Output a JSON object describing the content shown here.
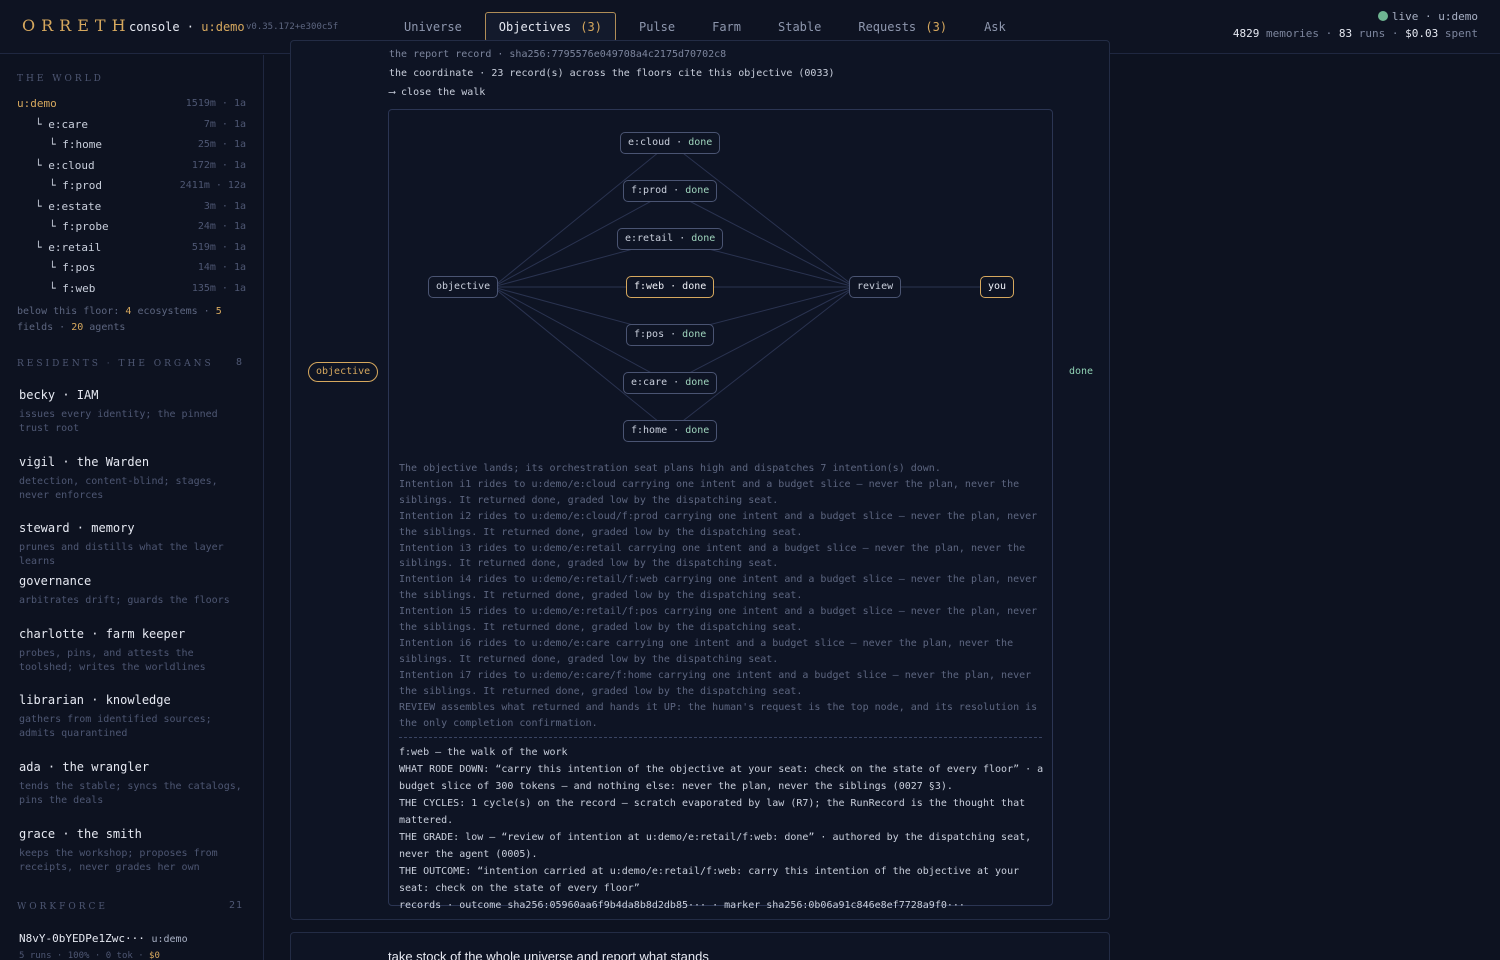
{
  "header": {
    "brand": "ORRETH",
    "console": "console",
    "sep": " · ",
    "user": "u:demo",
    "version": "v0.35.172+e300c5f",
    "nav": [
      {
        "label": "Universe"
      },
      {
        "label": "Objectives",
        "count": "(3)",
        "active": true
      },
      {
        "label": "Pulse"
      },
      {
        "label": "Farm"
      },
      {
        "label": "Stable"
      },
      {
        "label": "Requests",
        "count": "(3)"
      },
      {
        "label": "Ask"
      }
    ],
    "status": {
      "live_label": "live · u:demo",
      "memories": "4829",
      "memories_label": "memories",
      "runs": "83",
      "runs_label": "runs",
      "spent": "$0.03",
      "spent_label": "spent",
      "dot_color": "#6fb592"
    }
  },
  "sidebar": {
    "world_heading": "THE WORLD",
    "tree": [
      {
        "label": "u:demo",
        "meta": "1519m · 1a",
        "user": true
      },
      {
        "label": "└ e:care",
        "meta": "7m · 1a"
      },
      {
        "label": "└ f:home",
        "meta": "25m · 1a"
      },
      {
        "label": "└ e:cloud",
        "meta": "172m · 1a"
      },
      {
        "label": "└ f:prod",
        "meta": "2411m · 12a"
      },
      {
        "label": "└ e:estate",
        "meta": "3m · 1a"
      },
      {
        "label": "└ f:probe",
        "meta": "24m · 1a"
      },
      {
        "label": "└ e:retail",
        "meta": "519m · 1a"
      },
      {
        "label": "└ f:pos",
        "meta": "14m · 1a"
      },
      {
        "label": "└ f:web",
        "meta": "135m · 1a"
      }
    ],
    "below": {
      "prefix": "below this floor:",
      "ecosystems": "4",
      "ecosystems_label": "ecosystems ·",
      "fields": "5",
      "fields_label": "fields ·",
      "agents": "20",
      "agents_label": "agents"
    },
    "organs_heading": "RESIDENTS · THE ORGANS",
    "organs_count": "8",
    "organs": [
      {
        "title": "becky · IAM",
        "desc": "issues every identity; the pinned trust root"
      },
      {
        "title": "vigil · the Warden",
        "desc": "detection, content-blind; stages, never enforces"
      },
      {
        "title": "steward · memory",
        "desc": "prunes and distills what the layer learns"
      },
      {
        "title": "governance",
        "desc": "arbitrates drift; guards the floors"
      },
      {
        "title": "charlotte · farm keeper",
        "desc": "probes, pins, and attests the toolshed; writes the worldlines"
      },
      {
        "title": "librarian · knowledge",
        "desc": "gathers from identified sources; admits quarantined"
      },
      {
        "title": "ada · the wrangler",
        "desc": "tends the stable; syncs the catalogs, pins the deals"
      },
      {
        "title": "grace · the smith",
        "desc": "keeps the workshop; proposes from receipts, never grades her own"
      }
    ],
    "workforce_heading": "WORKFORCE",
    "workforce_count": "21",
    "worker": {
      "id": "N8vY-0bYEDPe1Zwc···",
      "user": "u:demo",
      "meta_a": "5 runs · 100% · 0 tok ·",
      "meta_b": "$0"
    }
  },
  "main": {
    "pre_lines": [
      "the report record · sha256:7795576e049708a4c2175d70702c8",
      "the coordinate · 23 record(s) across the floors cite this objective (0033)",
      "⟶ close the walk"
    ],
    "badge": "objective",
    "done": "done",
    "graph": {
      "objective": "objective",
      "review": "review",
      "you": "you",
      "status": "done",
      "intentions": [
        "e:cloud",
        "f:prod",
        "e:retail",
        "f:web",
        "f:pos",
        "e:care",
        "f:home"
      ],
      "highlight": "f:web"
    },
    "narrative": [
      "The objective lands; its orchestration seat plans high and dispatches 7 intention(s) down.",
      "Intention i1 rides to u:demo/e:cloud carrying one intent and a budget slice — never the plan, never the siblings. It returned done, graded low by the dispatching seat.",
      "Intention i2 rides to u:demo/e:cloud/f:prod carrying one intent and a budget slice — never the plan, never the siblings. It returned done, graded low by the dispatching seat.",
      "Intention i3 rides to u:demo/e:retail carrying one intent and a budget slice — never the plan, never the siblings. It returned done, graded low by the dispatching seat.",
      "Intention i4 rides to u:demo/e:retail/f:web carrying one intent and a budget slice — never the plan, never the siblings. It returned done, graded low by the dispatching seat.",
      "Intention i5 rides to u:demo/e:retail/f:pos carrying one intent and a budget slice — never the plan, never the siblings. It returned done, graded low by the dispatching seat.",
      "Intention i6 rides to u:demo/e:care carrying one intent and a budget slice — never the plan, never the siblings. It returned done, graded low by the dispatching seat.",
      "Intention i7 rides to u:demo/e:care/f:home carrying one intent and a budget slice — never the plan, never the siblings. It returned done, graded low by the dispatching seat.",
      "REVIEW assembles what returned and hands it UP: the human's request is the top node, and its resolution is the only completion confirmation."
    ],
    "walk": {
      "title": "f:web — the walk of the work",
      "rode": "WHAT RODE DOWN: “carry this intention of the objective at your seat: check on the state of every floor” · a budget slice of 300 tokens — and nothing else: never the plan, never the siblings (0027 §3).",
      "cycles": "THE CYCLES: 1 cycle(s) on the record — scratch evaporated by law (R7); the RunRecord is the thought that mattered.",
      "grade": "THE GRADE: low — “review of intention at u:demo/e:retail/f:web: done” · authored by the dispatching seat, never the agent (0005).",
      "outcome": "THE OUTCOME: “intention carried at u:demo/e:retail/f:web: carry this intention of the objective at your seat: check on the state of every floor”",
      "records": "records · outcome sha256:05960aa6f9b4da8b8d2db85··· · marker sha256:0b06a91c846e8ef7728a9f0···"
    },
    "next_card_title": "take stock of the whole universe and report what stands"
  },
  "colors": {
    "accent": "#d6a85e",
    "ok": "#9fd4bd",
    "bg": "#0d1220"
  }
}
